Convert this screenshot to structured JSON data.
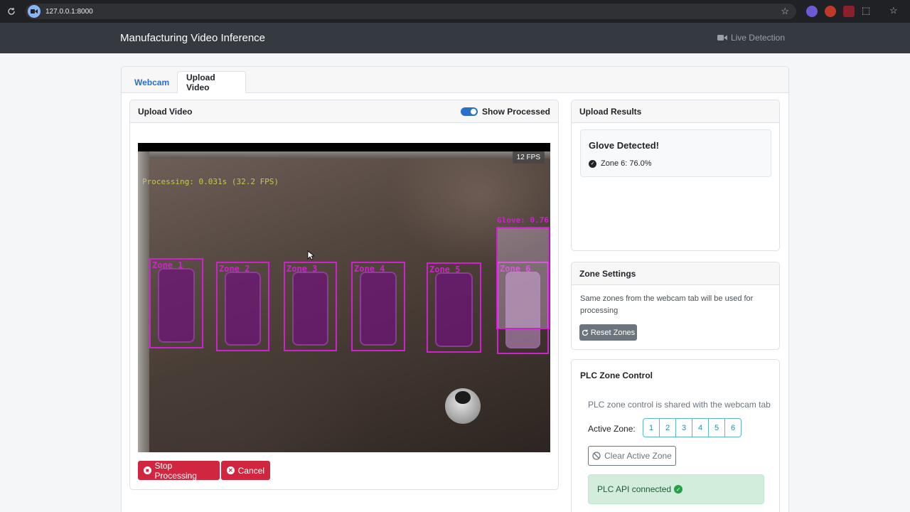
{
  "browser": {
    "url": "127.0.0.1:8000"
  },
  "navbar": {
    "brand": "Manufacturing Video Inference",
    "live_detection": "Live Detection"
  },
  "tabs": [
    {
      "label": "Webcam",
      "active": false
    },
    {
      "label": "Upload Video",
      "active": true
    }
  ],
  "upload": {
    "header": "Upload Video",
    "toggle_label": "Show Processed",
    "toggle_on": true,
    "video": {
      "fps_badge": "12 FPS",
      "processing_text": "Processing: 0.031s (32.2 FPS)",
      "zones": [
        "Zone 1",
        "Zone 2",
        "Zone 3",
        "Zone 4",
        "Zone 5",
        "Zone 6"
      ],
      "detection_label": "Glove: 0.76",
      "box_color": "#d020d0"
    },
    "stop_button": "Stop Processing",
    "cancel_button": "Cancel"
  },
  "results": {
    "header": "Upload Results",
    "title": "Glove Detected!",
    "detail": "Zone 6: 76.0%"
  },
  "zone_settings": {
    "header": "Zone Settings",
    "description": "Same zones from the webcam tab will be used for processing",
    "reset_button": "Reset Zones"
  },
  "plc": {
    "header": "PLC Zone Control",
    "description": "PLC zone control is shared with the webcam tab",
    "active_zone_label": "Active Zone:",
    "zone_buttons": [
      "1",
      "2",
      "3",
      "4",
      "5",
      "6"
    ],
    "clear_button": "Clear Active Zone",
    "api_status": "PLC API connected"
  },
  "colors": {
    "navbar": "#343a40",
    "primary": "#2a6fc9",
    "danger": "#d0263f",
    "success_bg": "#d3eddd",
    "zone_outline": "#d020d0"
  }
}
